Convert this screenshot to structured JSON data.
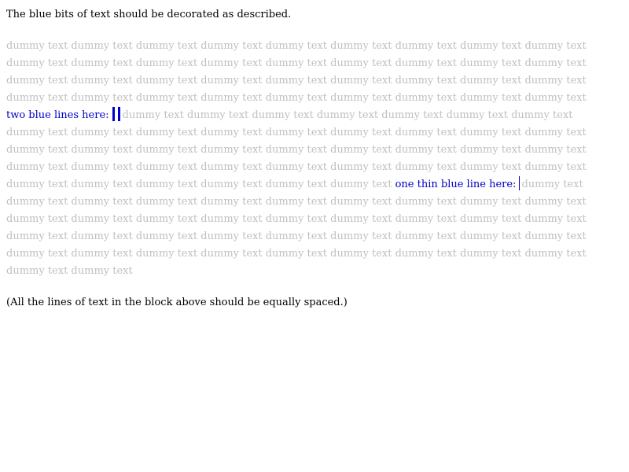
{
  "intro_text": "The blue bits of text should be decorated as described.",
  "dummy": {
    "full_line": "dummy text dummy text dummy text dummy text dummy text dummy text dummy text dummy text dummy text",
    "after_two_lines": "dummy text dummy text dummy text dummy text dummy text dummy text dummy text",
    "before_one_line": "dummy text dummy text dummy text dummy text dummy text dummy text ",
    "after_one_line": "dummy text",
    "last_line": "dummy text dummy text"
  },
  "markers": {
    "two_lines_label": "two blue lines here:",
    "one_line_label": "one thin blue line here:"
  },
  "outro_text": "(All the lines of text in the block above should be equally spaced.)",
  "colors": {
    "dummy_text": "#c0c0c0",
    "blue_text": "#0000c8",
    "body_text": "#000000"
  }
}
